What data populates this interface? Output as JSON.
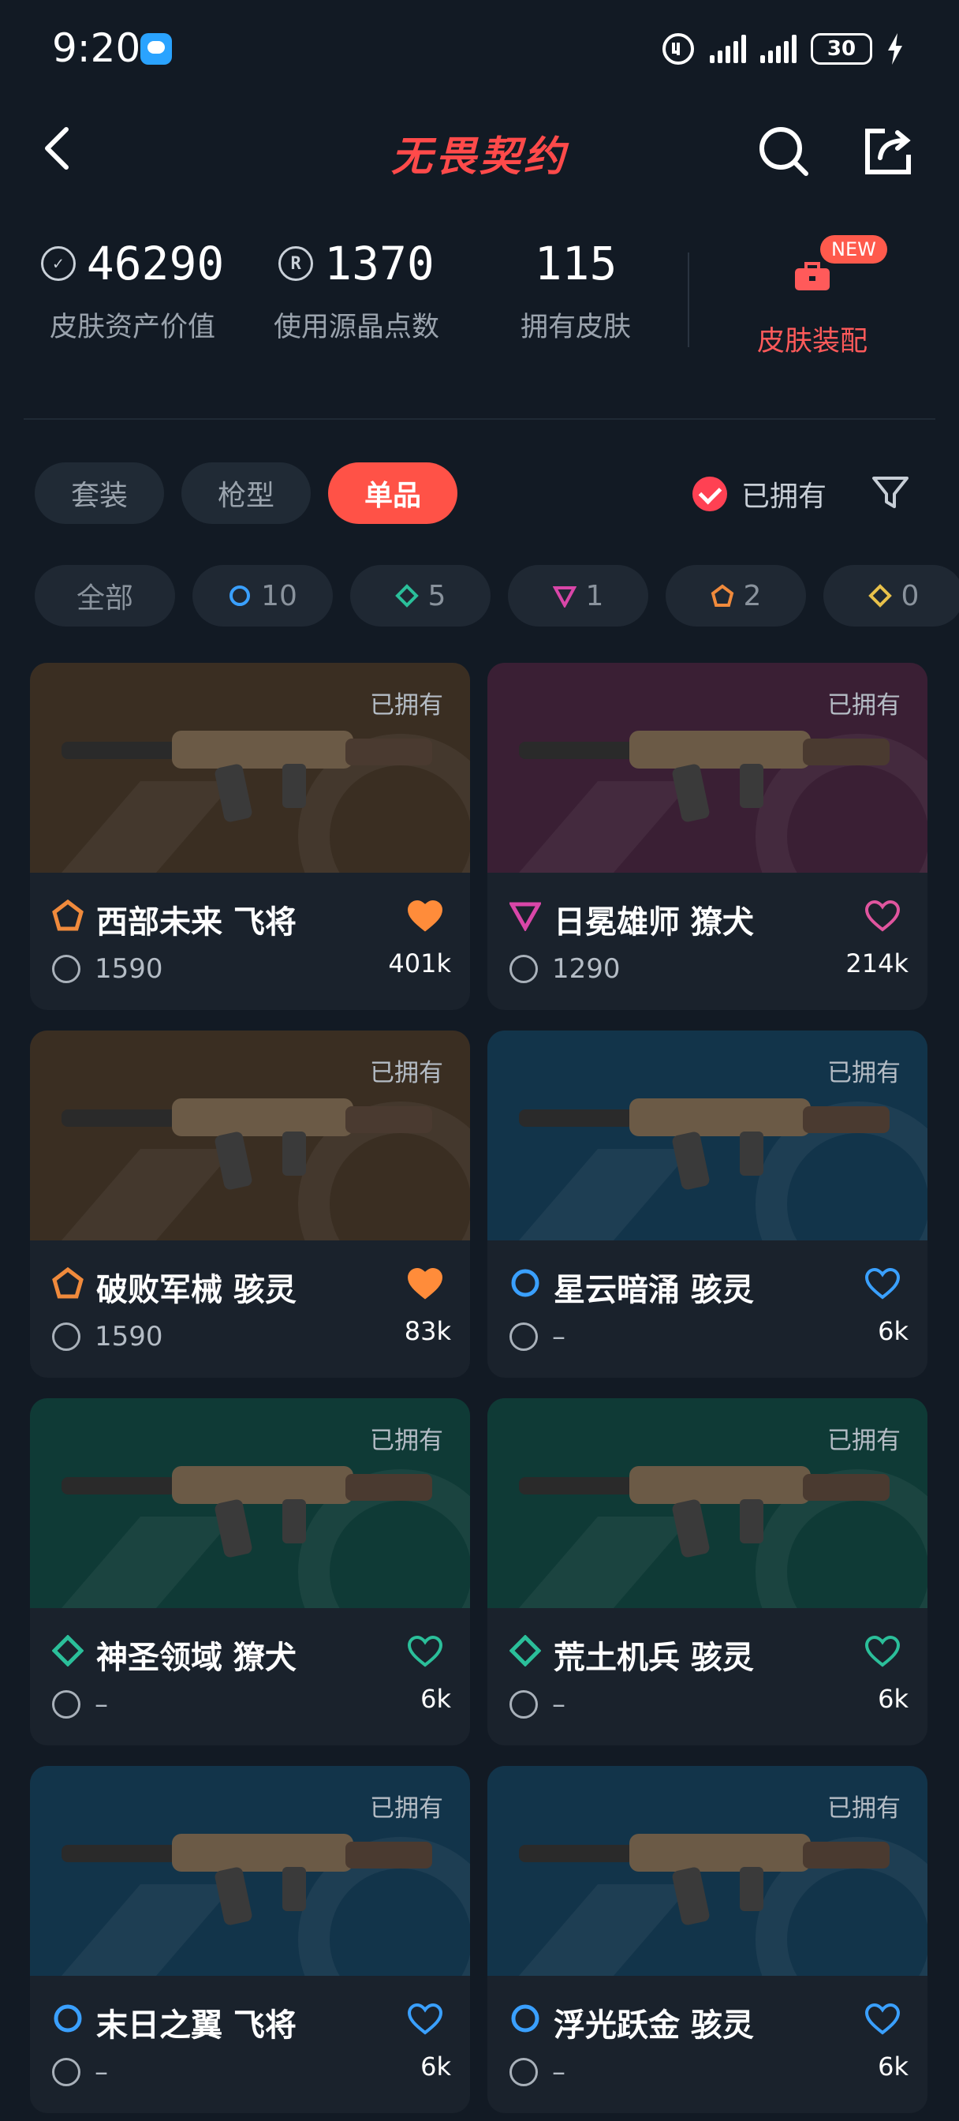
{
  "status_bar": {
    "time": "9:20",
    "battery": "30"
  },
  "header": {
    "title": "无畏契约"
  },
  "stats": [
    {
      "value": "46290",
      "label": "皮肤资产价值",
      "icon": "vp-coin-icon"
    },
    {
      "value": "1370",
      "label": "使用源晶点数",
      "icon": "radianite-icon"
    },
    {
      "value": "115",
      "label": "拥有皮肤",
      "icon": ""
    }
  ],
  "equip": {
    "label": "皮肤装配",
    "badge": "NEW"
  },
  "tabs": [
    "套装",
    "枪型",
    "单品"
  ],
  "owned_filter": {
    "label": "已拥有"
  },
  "rarity_chips": [
    {
      "label": "全部",
      "color": ""
    },
    {
      "label": "10",
      "color": "#3aa0ff"
    },
    {
      "label": "5",
      "color": "#2bbf9a"
    },
    {
      "label": "1",
      "color": "#d946a8"
    },
    {
      "label": "2",
      "color": "#f08a3c"
    },
    {
      "label": "0",
      "color": "#e8c14a"
    }
  ],
  "items": [
    {
      "name": "西部未来 飞将",
      "price": "1590",
      "likes": "401k",
      "owned": "已拥有",
      "rarity_color": "#f08a3c",
      "heart_color": "#ff8c3a",
      "liked": true,
      "bg": "#3a2e22"
    },
    {
      "name": "日冕雄师 獠犬",
      "price": "1290",
      "likes": "214k",
      "owned": "已拥有",
      "rarity_color": "#d946a8",
      "heart_color": "#e0559e",
      "liked": false,
      "bg": "#3a1f34"
    },
    {
      "name": "破败军械 骇灵",
      "price": "1590",
      "likes": "83k",
      "owned": "已拥有",
      "rarity_color": "#f08a3c",
      "heart_color": "#ff8c3a",
      "liked": true,
      "bg": "#3a2e22"
    },
    {
      "name": "星云暗涌 骇灵",
      "price": "–",
      "likes": "6k",
      "owned": "已拥有",
      "rarity_color": "#3aa0ff",
      "heart_color": "#3aa0ff",
      "liked": false,
      "bg": "#12344a"
    },
    {
      "name": "神圣领域 獠犬",
      "price": "–",
      "likes": "6k",
      "owned": "已拥有",
      "rarity_color": "#2bbf9a",
      "heart_color": "#2bbf9a",
      "liked": false,
      "bg": "#0f3a36"
    },
    {
      "name": "荒土机兵 骇灵",
      "price": "–",
      "likes": "6k",
      "owned": "已拥有",
      "rarity_color": "#2bbf9a",
      "heart_color": "#2bbf9a",
      "liked": false,
      "bg": "#0f3a36"
    },
    {
      "name": "末日之翼 飞将",
      "price": "–",
      "likes": "6k",
      "owned": "已拥有",
      "rarity_color": "#3aa0ff",
      "heart_color": "#3aa0ff",
      "liked": false,
      "bg": "#12344a"
    },
    {
      "name": "浮光跃金 骇灵",
      "price": "–",
      "likes": "6k",
      "owned": "已拥有",
      "rarity_color": "#3aa0ff",
      "heart_color": "#3aa0ff",
      "liked": false,
      "bg": "#12344a"
    }
  ]
}
